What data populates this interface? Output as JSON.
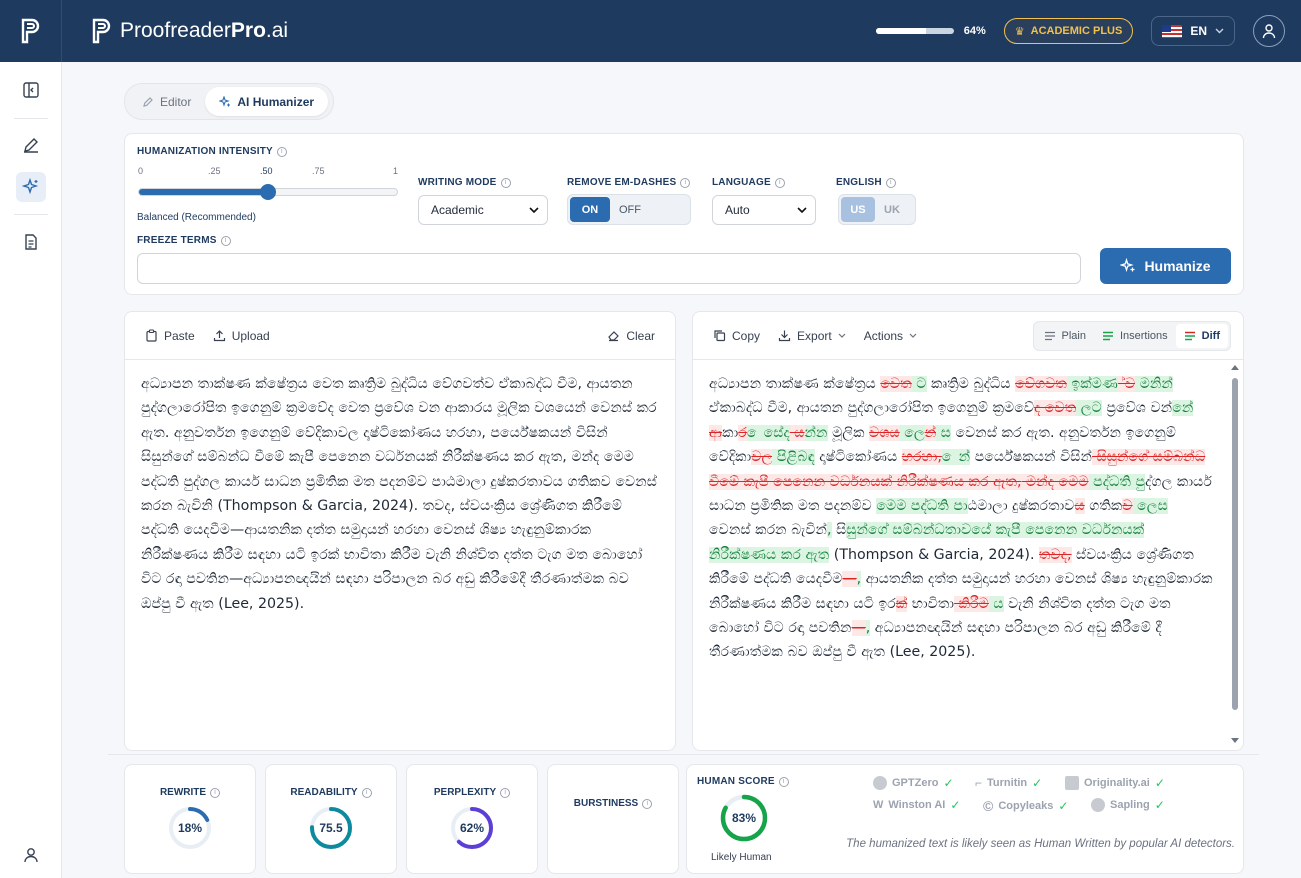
{
  "brand": {
    "name_light": "Proofreader",
    "name_bold": "Pro",
    "name_suffix": ".ai"
  },
  "header": {
    "usage_percent": 64,
    "usage_label": "64%",
    "plan_badge": "ACADEMIC PLUS",
    "language": "EN",
    "accent": "#1e3a5f",
    "badge_color": "#f2c14e"
  },
  "rail": {
    "icons": [
      "sidebar-toggle-icon",
      "pen-icon",
      "sparkle-icon",
      "document-icon",
      "user-icon"
    ]
  },
  "mode_tabs": {
    "editor": "Editor",
    "humanizer": "AI Humanizer"
  },
  "settings": {
    "intensity": {
      "label": "HUMANIZATION INTENSITY",
      "ticks": [
        "0",
        ".25",
        ".50",
        ".75",
        "1"
      ],
      "value": 0.5,
      "caption": "Balanced (Recommended)"
    },
    "writing_mode": {
      "label": "WRITING MODE",
      "value": "Academic"
    },
    "em_dashes": {
      "label": "REMOVE EM-DASHES",
      "on": "ON",
      "off": "OFF"
    },
    "language": {
      "label": "LANGUAGE",
      "value": "Auto"
    },
    "english": {
      "label": "ENGLISH",
      "us": "US",
      "uk": "UK"
    },
    "freeze": {
      "label": "FREEZE TERMS",
      "value": ""
    },
    "humanize_button": "Humanize"
  },
  "left_panel": {
    "paste": "Paste",
    "upload": "Upload",
    "clear": "Clear",
    "text": "අධ්‍යාපන තාක්ෂණ ක්ෂේත්‍රය වෙත කෘත්‍රිම බුද්ධිය වේගවත්ව ඒකාබද්ධ වීම, ආයතන පුද්ගලාරෝපිත ඉගෙනුම් ක්‍රමවේද වෙත ප්‍රවේශ වන ආකාරය මූලික වශයෙන් වෙනස් කර ඇත. අනුවර්තන ඉගෙනුම් වේදිකාවල දෘෂ්ටිකෝණය හරහා, පර්යේෂකයන් විසින් සිසුන්ගේ සම්බන්ධ වීමේ කැපී පෙනෙන වර්ධනයක් නිරීක්ෂණය කර ඇත, මන්ද මෙම පද්ධති පුද්ගල කාර්ය සාධන ප්‍රමිතික මත පදනම්ව පාඨමාලා දුෂ්කරතාවය ගතිකව වෙනස් කරන බැවිනි (Thompson & Garcia, 2024). තවද, ස්වයංක්‍රිය ශ්‍රේණිගත කිරීමේ පද්ධති යෙදවීම—ආයතනික දත්ත සමුදායන් හරහා වෙනස් ශිෂ්‍ය හැඳුනුම්කාරක නිරීක්ෂණය කිරීම සඳහා යටි ඉරක් භාවිතා කිරීම වැනි නිශ්චිත දත්ත ටැග මත බොහෝ විට රඳා පවතින—අධ්‍යාපනඥයින් සඳහා පරිපාලන බර අඩු කිරීමේදී තීරණාත්මක බව ඔප්පු වී ඇත (Lee, 2025)."
  },
  "right_panel": {
    "copy": "Copy",
    "export": "Export",
    "actions": "Actions",
    "views": {
      "plain": "Plain",
      "insertions": "Insertions",
      "diff": "Diff"
    },
    "diff": [
      {
        "t": "අධ්‍යාපන තාක්ෂණ ක්ෂේත්‍රය "
      },
      {
        "t": "වෙත",
        "k": "del"
      },
      {
        "t": " ට",
        "k": "ins"
      },
      {
        "t": " කෘත්‍රිම බුද්ධිය "
      },
      {
        "t": "වේගවත",
        "k": "del"
      },
      {
        "t": " ඉක්මණ",
        "k": "ins"
      },
      {
        "t": " ්ව",
        "k": "del"
      },
      {
        "t": " මනින්",
        "k": "ins"
      },
      {
        "t": " ඒකාබද්ධ වීම, ආයතන පුද්ගලාරෝපිත ඉගෙනුම් ක්‍රමව"
      },
      {
        "t": "ේද වෙත",
        "k": "del"
      },
      {
        "t": " ලට",
        "k": "ins"
      },
      {
        "t": " ප්‍රවේශ වන"
      },
      {
        "t": "්නේ",
        "k": "ins"
      },
      {
        "t": " ආ",
        "k": "del"
      },
      {
        "t": "ක"
      },
      {
        "t": "ාර",
        "k": "del"
      },
      {
        "t": " ෙසේද",
        "k": "ins"
      },
      {
        "t": " ය",
        "k": "del"
      },
      {
        "t": "න්න",
        "k": "ins"
      },
      {
        "t": " මූලික "
      },
      {
        "t": "වශය",
        "k": "del"
      },
      {
        "t": " ල",
        "k": "ins"
      },
      {
        "t": "ෙන්",
        "k": "del"
      },
      {
        "t": " ස",
        "k": "ins"
      },
      {
        "t": " වෙනස් කර ඇත. අනුවර්තන ඉගෙනුම් වේදිකා"
      },
      {
        "t": "වල",
        "k": "del"
      },
      {
        "t": " පිළිබඳ",
        "k": "ins"
      },
      {
        "t": " දෘෂ්ටිකෝණය "
      },
      {
        "t": "හරහා,",
        "k": "del"
      },
      {
        "t": " ෙන්",
        "k": "ins"
      },
      {
        "t": " පර්යේෂකයන් විසින්"
      },
      {
        "t": " සිසුන්ගේ සම්බන්ධ වීමේ කැපී පෙනෙන වර්ධනයක් නිරීක්ෂණය කර ඇත,",
        "k": "del"
      },
      {
        "t": " මන්ද මෙම",
        "k": "del"
      },
      {
        "t": " පද්ධති පු",
        "k": "ins"
      },
      {
        "t": "ද්ගල කාර්ය සාධන ප්‍රමිතික මත පදනම්ව "
      },
      {
        "t": "මෙම පද්ධති ප",
        "k": "ins"
      },
      {
        "t": "ාඨමාලා දුෂ්කරතාව"
      },
      {
        "t": "ය",
        "k": "del"
      },
      {
        "t": " ගතික"
      },
      {
        "t": "ව",
        "k": "del"
      },
      {
        "t": " ලෙස",
        "k": "ins"
      },
      {
        "t": " වෙනස් කරන බැවින"
      },
      {
        "t": "්,",
        "k": "ins"
      },
      {
        "t": " ස"
      },
      {
        "t": "ිසුන්ගේ සම්බන්ධතාවයේ කැපී පෙනෙන වර්ධනයක් නිරීක්ෂණය කර ඇත",
        "k": "ins"
      },
      {
        "t": " (Thompson & Garcia, 2024). "
      },
      {
        "t": "තවද,",
        "k": "del"
      },
      {
        "t": " ස්වයංක්‍රිය ශ්‍රේණිගත කිරීමේ පද්ධති යෙදවීම"
      },
      {
        "t": "—",
        "k": "del"
      },
      {
        "t": ",",
        "k": "ins"
      },
      {
        "t": " ආයතනික දත්ත සමුදායන් හරහා වෙනස් ශිෂ්‍ය හැඳුනුම්කාරක නිරීක්ෂණය කිරීම සඳහා යටි ඉර"
      },
      {
        "t": "ක්",
        "k": "del"
      },
      {
        "t": " භාවිත"
      },
      {
        "t": "ා කිරීම",
        "k": "del"
      },
      {
        "t": " ය",
        "k": "ins"
      },
      {
        "t": " වැනි නිශ්චිත දත්ත ටැග මත බොහෝ විට රඳා පවතින"
      },
      {
        "t": "—",
        "k": "del"
      },
      {
        "t": ",",
        "k": "ins"
      },
      {
        "t": " අධ්‍යාපනඥයින් සඳහා පරිපාලන බර අඩු කිරීමේ දී තීරණාත්මක බව ඔප්පු වී ඇත (Lee, 2025)."
      }
    ]
  },
  "metrics": {
    "rewrite": {
      "label": "REWRITE",
      "value": 18,
      "display": "18%",
      "color": "#2b6cb0"
    },
    "readability": {
      "label": "READABILITY",
      "value": 75.5,
      "display": "75.5",
      "color": "#0e8a9e"
    },
    "perplexity": {
      "label": "PERPLEXITY",
      "value": 62,
      "display": "62%",
      "color": "#5b3fd6"
    },
    "burstiness": {
      "label": "BURSTINESS"
    }
  },
  "human_score": {
    "label": "HUMAN SCORE",
    "value": 83,
    "display": "83%",
    "verdict": "Likely Human",
    "color": "#16a34a",
    "detectors": [
      "GPTZero",
      "Turnitin",
      "Originality.ai",
      "Winston AI",
      "Copyleaks",
      "Sapling"
    ],
    "note": "The humanized text is likely seen as Human Written by popular AI detectors."
  }
}
